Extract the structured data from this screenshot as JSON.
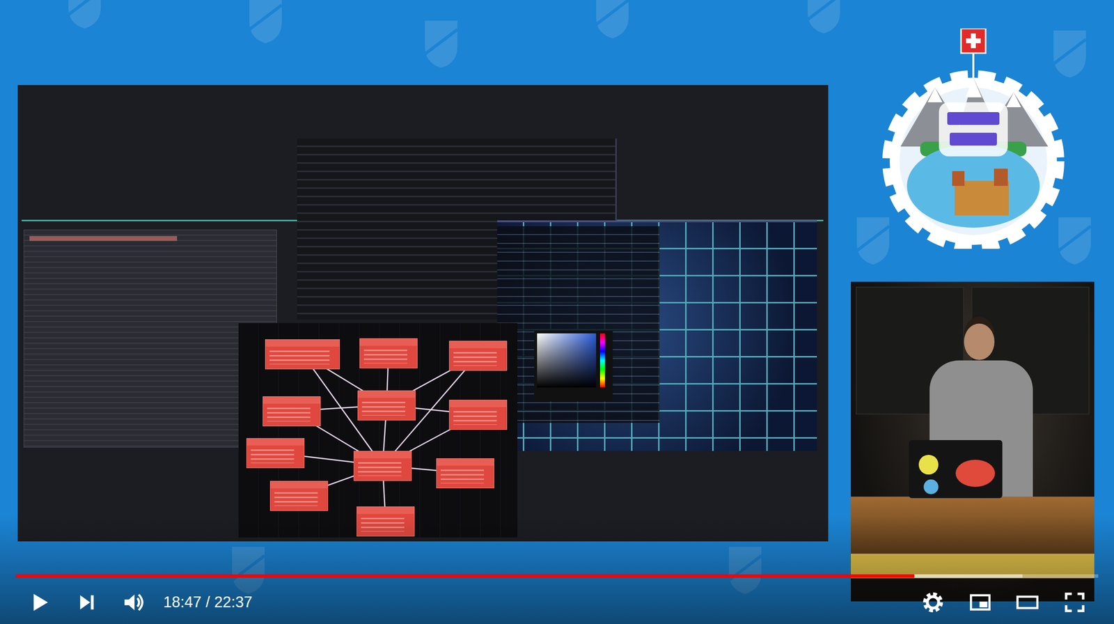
{
  "player": {
    "playing": false,
    "muted": false,
    "time": "18:47 / 22:37",
    "progress": {
      "level": 0.83
    },
    "buffered": {
      "level": 0.93
    }
  }
}
